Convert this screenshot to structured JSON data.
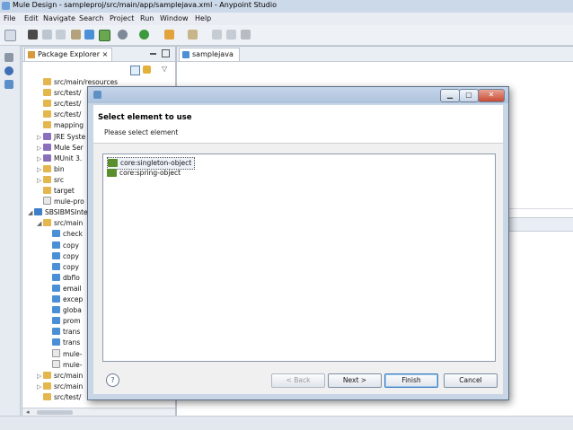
{
  "window": {
    "title": "Mule Design - sampleproj/src/main/app/samplejava.xml - Anypoint Studio"
  },
  "menu": [
    "File",
    "Edit",
    "Navigate",
    "Search",
    "Project",
    "Run",
    "Window",
    "Help"
  ],
  "package_explorer": {
    "tab_label": "Package Explorer",
    "tree": [
      {
        "label": "src/main/resources",
        "icon": "folder-icon",
        "indent": 1
      },
      {
        "label": "src/test/",
        "icon": "folder-icon",
        "indent": 1
      },
      {
        "label": "src/test/",
        "icon": "folder-icon",
        "indent": 1
      },
      {
        "label": "src/test/",
        "icon": "folder-icon",
        "indent": 1
      },
      {
        "label": "mapping",
        "icon": "folder-icon",
        "indent": 1
      },
      {
        "label": "JRE Syste",
        "icon": "library-icon",
        "indent": 1,
        "twisty": "▷"
      },
      {
        "label": "Mule Ser",
        "icon": "library-icon",
        "indent": 1,
        "twisty": "▷"
      },
      {
        "label": "MUnit 3.",
        "icon": "library-icon",
        "indent": 1,
        "twisty": "▷"
      },
      {
        "label": "bin",
        "icon": "folder-icon",
        "indent": 1,
        "twisty": "▷"
      },
      {
        "label": "src",
        "icon": "folder-icon",
        "indent": 1,
        "twisty": "▷"
      },
      {
        "label": "target",
        "icon": "folder-icon",
        "indent": 1
      },
      {
        "label": "mule-pro",
        "icon": "file-icon",
        "indent": 1
      },
      {
        "label": "SBSIBMSInte",
        "icon": "project-icon",
        "indent": 0,
        "twisty": "◢"
      },
      {
        "label": "src/main",
        "icon": "folder-icon",
        "indent": 1,
        "twisty": "◢"
      },
      {
        "label": "check",
        "icon": "mule-icon",
        "indent": 2
      },
      {
        "label": "copy",
        "icon": "mule-icon",
        "indent": 2
      },
      {
        "label": "copy",
        "icon": "mule-icon",
        "indent": 2
      },
      {
        "label": "copy",
        "icon": "mule-icon",
        "indent": 2
      },
      {
        "label": "dbflo",
        "icon": "mule-icon",
        "indent": 2
      },
      {
        "label": "email",
        "icon": "mule-icon",
        "indent": 2
      },
      {
        "label": "excep",
        "icon": "mule-icon",
        "indent": 2
      },
      {
        "label": "globa",
        "icon": "mule-icon",
        "indent": 2
      },
      {
        "label": "prom",
        "icon": "mule-icon",
        "indent": 2
      },
      {
        "label": "trans",
        "icon": "mule-icon",
        "indent": 2
      },
      {
        "label": "trans",
        "icon": "mule-icon",
        "indent": 2
      },
      {
        "label": "mule-",
        "icon": "file-icon",
        "indent": 2
      },
      {
        "label": "mule-",
        "icon": "file-icon",
        "indent": 2
      },
      {
        "label": "src/main",
        "icon": "folder-icon",
        "indent": 1,
        "twisty": "▷"
      },
      {
        "label": "src/main",
        "icon": "folder-icon",
        "indent": 1,
        "twisty": "▷"
      },
      {
        "label": "src/test/",
        "icon": "folder-icon",
        "indent": 1
      }
    ]
  },
  "editor": {
    "tab_label": "samplejava"
  },
  "dialog": {
    "title": "Select element to use",
    "message": "Please select element",
    "items": [
      {
        "label": "core:singleton-object",
        "selected": true
      },
      {
        "label": "core:spring-object",
        "selected": false
      }
    ],
    "buttons": {
      "help": "?",
      "back": "< Back",
      "next": "Next >",
      "finish": "Finish",
      "cancel": "Cancel"
    }
  },
  "colors": {
    "accent": "#3d7fc0",
    "dialog_frame": "#c9d6e6",
    "close_button": "#c74a33"
  }
}
